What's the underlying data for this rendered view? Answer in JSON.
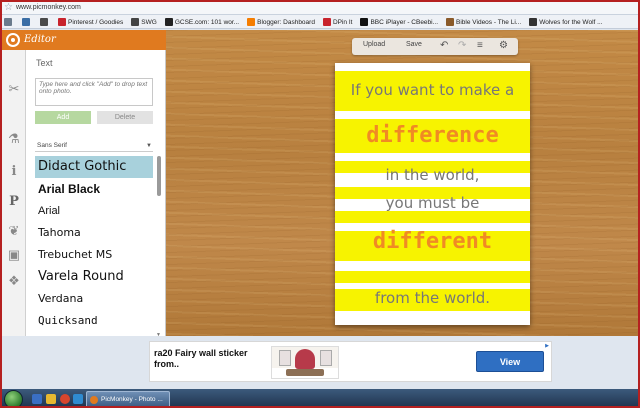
{
  "browser": {
    "url": "www.picmonkey.com",
    "bookmarks": [
      {
        "label": "",
        "color": "#6b7b8c"
      },
      {
        "label": "",
        "color": "#3b6ea5"
      },
      {
        "label": "",
        "color": "#4a4a4a"
      },
      {
        "label": "Pinterest / Goodies",
        "color": "#c8232c"
      },
      {
        "label": "SWG",
        "color": "#444444"
      },
      {
        "label": "GCSE.com: 101 wor...",
        "color": "#222222"
      },
      {
        "label": "Blogger: Dashboard",
        "color": "#f57d00"
      },
      {
        "label": "DPin It",
        "color": "#c8232c"
      },
      {
        "label": "BBC iPlayer - CBeebi...",
        "color": "#111111"
      },
      {
        "label": "Bible Videos - The Li...",
        "color": "#8a5a2a"
      },
      {
        "label": "Wolves for the Wolf ...",
        "color": "#333333"
      }
    ]
  },
  "editor": {
    "title": "Editor",
    "panel_label": "Text",
    "text_placeholder": "Type here and click \"Add\" to drop text onto photo.",
    "add_label": "Add",
    "delete_label": "Delete",
    "font_category": "Sans Serif",
    "fonts": [
      {
        "label": "Didact Gothic",
        "selected": true,
        "family": "\"DejaVu Sans\", sans-serif",
        "size": "13px",
        "weight": "normal"
      },
      {
        "label": "Arial Black",
        "selected": false,
        "family": "\"Liberation Sans\", sans-serif",
        "size": "12px",
        "weight": "900"
      },
      {
        "label": "Arial",
        "selected": false,
        "family": "\"Liberation Sans\", sans-serif",
        "size": "11px",
        "weight": "normal"
      },
      {
        "label": "Tahoma",
        "selected": false,
        "family": "\"DejaVu Sans\", sans-serif",
        "size": "11px",
        "weight": "normal"
      },
      {
        "label": "Trebuchet MS",
        "selected": false,
        "family": "\"DejaVu Sans\", sans-serif",
        "size": "11px",
        "weight": "normal"
      },
      {
        "label": "Varela Round",
        "selected": false,
        "family": "\"DejaVu Sans\", sans-serif",
        "size": "13px",
        "weight": "normal"
      },
      {
        "label": "Verdana",
        "selected": false,
        "family": "\"DejaVu Sans\", sans-serif",
        "size": "11px",
        "weight": "normal"
      },
      {
        "label": "Quicksand",
        "selected": false,
        "family": "\"DejaVu Sans Mono\", monospace",
        "size": "11px",
        "weight": "normal"
      }
    ]
  },
  "toolbar": {
    "upload_label": "Upload",
    "save_label": "Save"
  },
  "design": {
    "line1": "If you want to make a",
    "line2": "difference",
    "line3": "in the world,",
    "line4": "you must be",
    "line5": "different",
    "line6": "from the world.",
    "stripe_color": "#f7f300",
    "accent_color": "#f08a24"
  },
  "ad": {
    "text": "ra20 Fairy wall sticker from..",
    "button_label": "View"
  },
  "taskbar": {
    "task_label": "PicMonkey - Photo ..."
  },
  "colors": {
    "brand_orange": "#e07a1f",
    "selected_font_bg": "#a8d1dc",
    "view_button": "#2f6fc2"
  }
}
